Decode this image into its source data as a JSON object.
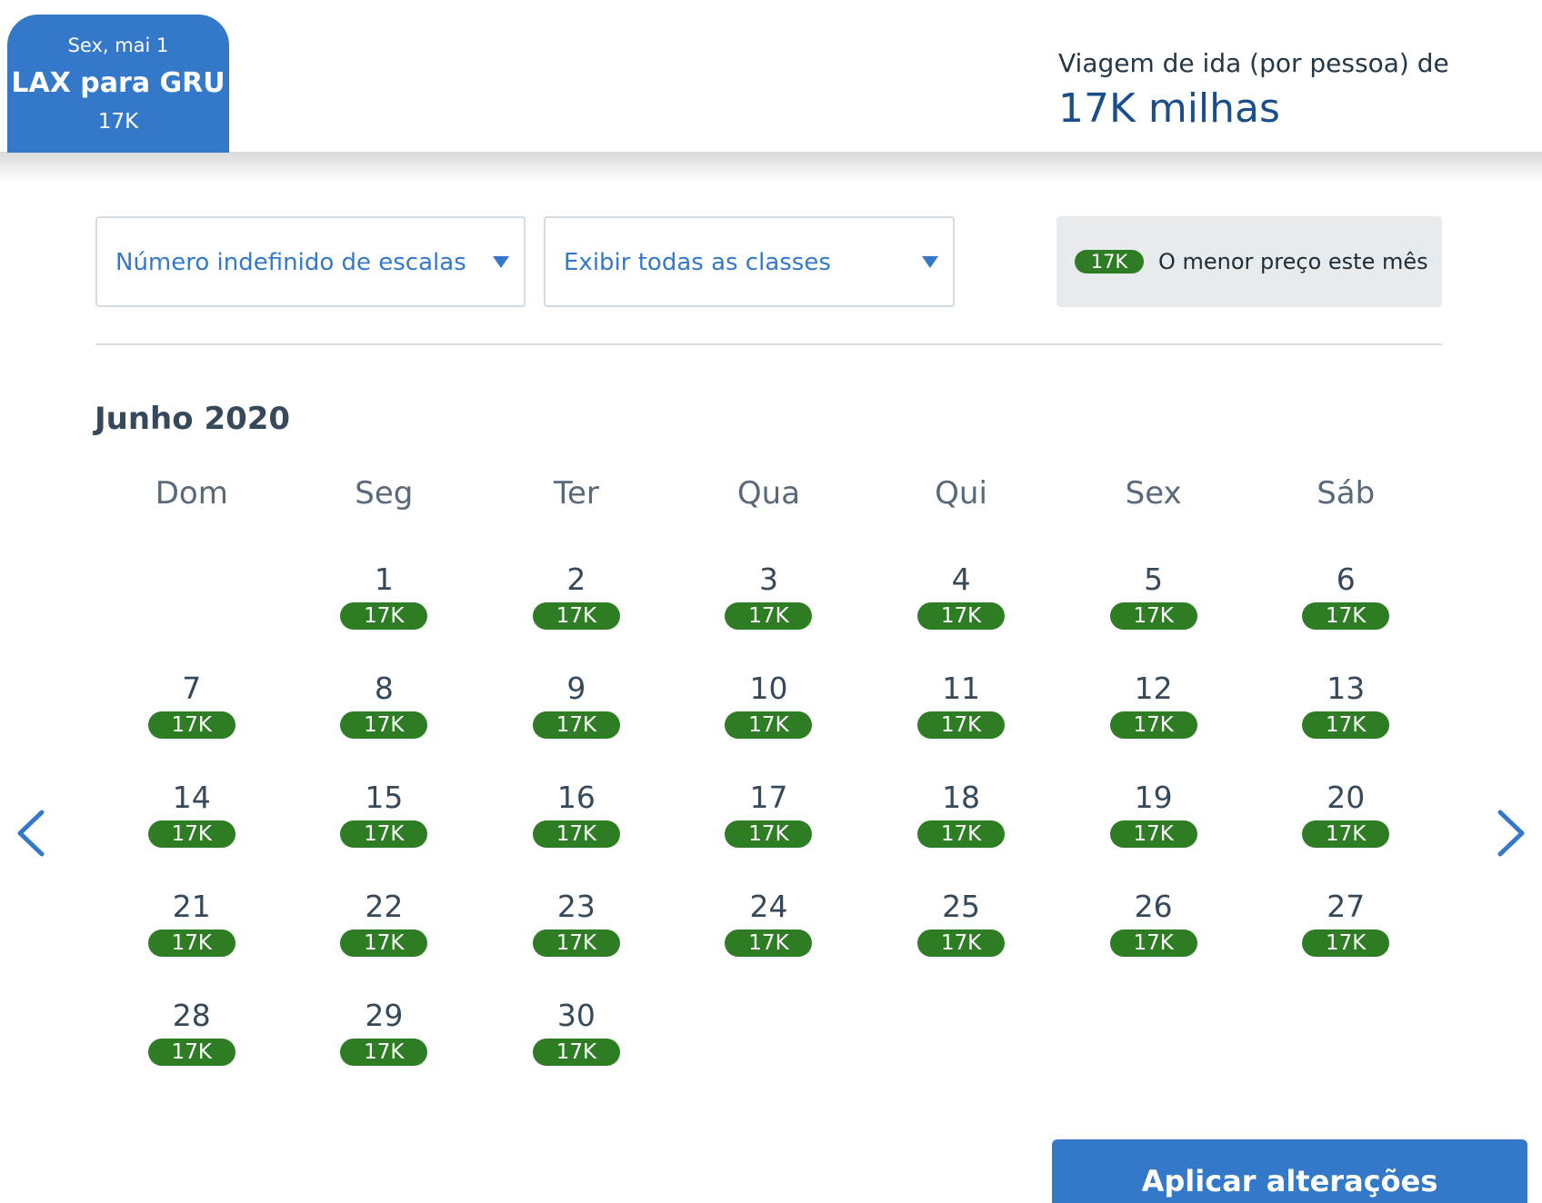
{
  "header": {
    "tab": {
      "date": "Sex, mai 1",
      "route": "LAX para GRU",
      "price": "17K"
    },
    "fare": {
      "label": "Viagem de ida (por pessoa) de",
      "value": "17K milhas"
    }
  },
  "filters": {
    "stops": "Número indefinido de escalas",
    "cabin": "Exibir todas as classes"
  },
  "legend": {
    "badge": "17K",
    "text": "O menor preço este mês",
    "color": "#2e7d24"
  },
  "calendar": {
    "month": "Junho 2020",
    "weekdays": [
      "Dom",
      "Seg",
      "Ter",
      "Qua",
      "Qui",
      "Sex",
      "Sáb"
    ],
    "leading_blank_days": 1,
    "days": [
      {
        "day": "1",
        "price": "17K"
      },
      {
        "day": "2",
        "price": "17K"
      },
      {
        "day": "3",
        "price": "17K"
      },
      {
        "day": "4",
        "price": "17K"
      },
      {
        "day": "5",
        "price": "17K"
      },
      {
        "day": "6",
        "price": "17K"
      },
      {
        "day": "7",
        "price": "17K"
      },
      {
        "day": "8",
        "price": "17K"
      },
      {
        "day": "9",
        "price": "17K"
      },
      {
        "day": "10",
        "price": "17K"
      },
      {
        "day": "11",
        "price": "17K"
      },
      {
        "day": "12",
        "price": "17K"
      },
      {
        "day": "13",
        "price": "17K"
      },
      {
        "day": "14",
        "price": "17K"
      },
      {
        "day": "15",
        "price": "17K"
      },
      {
        "day": "16",
        "price": "17K"
      },
      {
        "day": "17",
        "price": "17K"
      },
      {
        "day": "18",
        "price": "17K"
      },
      {
        "day": "19",
        "price": "17K"
      },
      {
        "day": "20",
        "price": "17K"
      },
      {
        "day": "21",
        "price": "17K"
      },
      {
        "day": "22",
        "price": "17K"
      },
      {
        "day": "23",
        "price": "17K"
      },
      {
        "day": "24",
        "price": "17K"
      },
      {
        "day": "25",
        "price": "17K"
      },
      {
        "day": "26",
        "price": "17K"
      },
      {
        "day": "27",
        "price": "17K"
      },
      {
        "day": "28",
        "price": "17K"
      },
      {
        "day": "29",
        "price": "17K"
      },
      {
        "day": "30",
        "price": "17K"
      }
    ]
  },
  "nav": {
    "prev_icon": "chevron-left-icon",
    "next_icon": "chevron-right-icon"
  },
  "actions": {
    "apply": "Aplicar alterações"
  },
  "colors": {
    "accent": "#3478c9",
    "price_badge": "#2e7d24",
    "fare_value": "#1a4f8b"
  }
}
